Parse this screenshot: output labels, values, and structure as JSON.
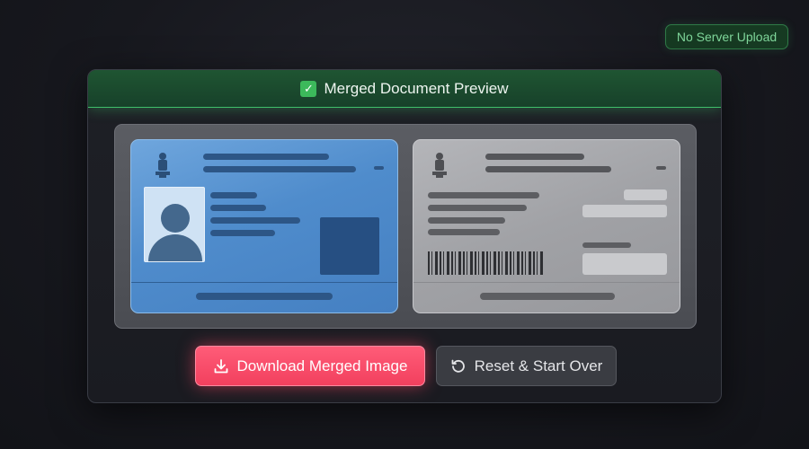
{
  "badge": {
    "label": "No Server Upload",
    "color": "#7fd69a"
  },
  "preview": {
    "title": "Merged Document Preview",
    "title_icon": "check-box-icon"
  },
  "cards": {
    "front": {
      "color": "#4f8ccc",
      "elements": [
        "emblem-icon",
        "portrait-icon",
        "qr-block"
      ]
    },
    "back": {
      "color": "#a1a2a6",
      "elements": [
        "emblem-icon",
        "barcode"
      ]
    }
  },
  "actions": {
    "download_label": "Download Merged Image",
    "download_icon": "download-icon",
    "download_color": "#f2405e",
    "reset_label": "Reset & Start Over",
    "reset_icon": "reset-icon"
  }
}
